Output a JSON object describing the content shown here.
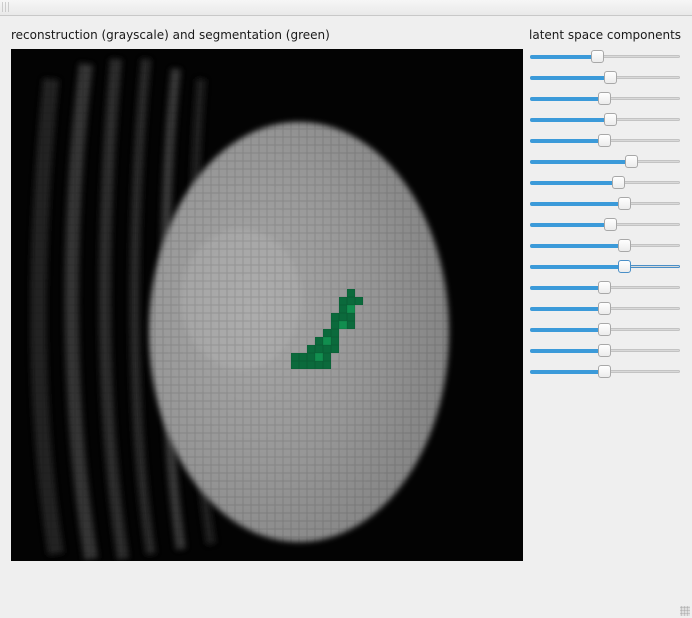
{
  "labels": {
    "reconstruction": "reconstruction (grayscale) and segmentation (green)",
    "latent": "latent space components"
  },
  "colors": {
    "accent": "#3b9ad9",
    "segmentation": "#0b6a3c",
    "background": "#efefef"
  },
  "sliders": [
    {
      "value": 0.45
    },
    {
      "value": 0.54
    },
    {
      "value": 0.5
    },
    {
      "value": 0.54
    },
    {
      "value": 0.5
    },
    {
      "value": 0.68
    },
    {
      "value": 0.59
    },
    {
      "value": 0.63
    },
    {
      "value": 0.54
    },
    {
      "value": 0.63
    },
    {
      "value": 0.63,
      "focused": true
    },
    {
      "value": 0.5
    },
    {
      "value": 0.5
    },
    {
      "value": 0.5
    },
    {
      "value": 0.5
    },
    {
      "value": 0.5
    }
  ]
}
